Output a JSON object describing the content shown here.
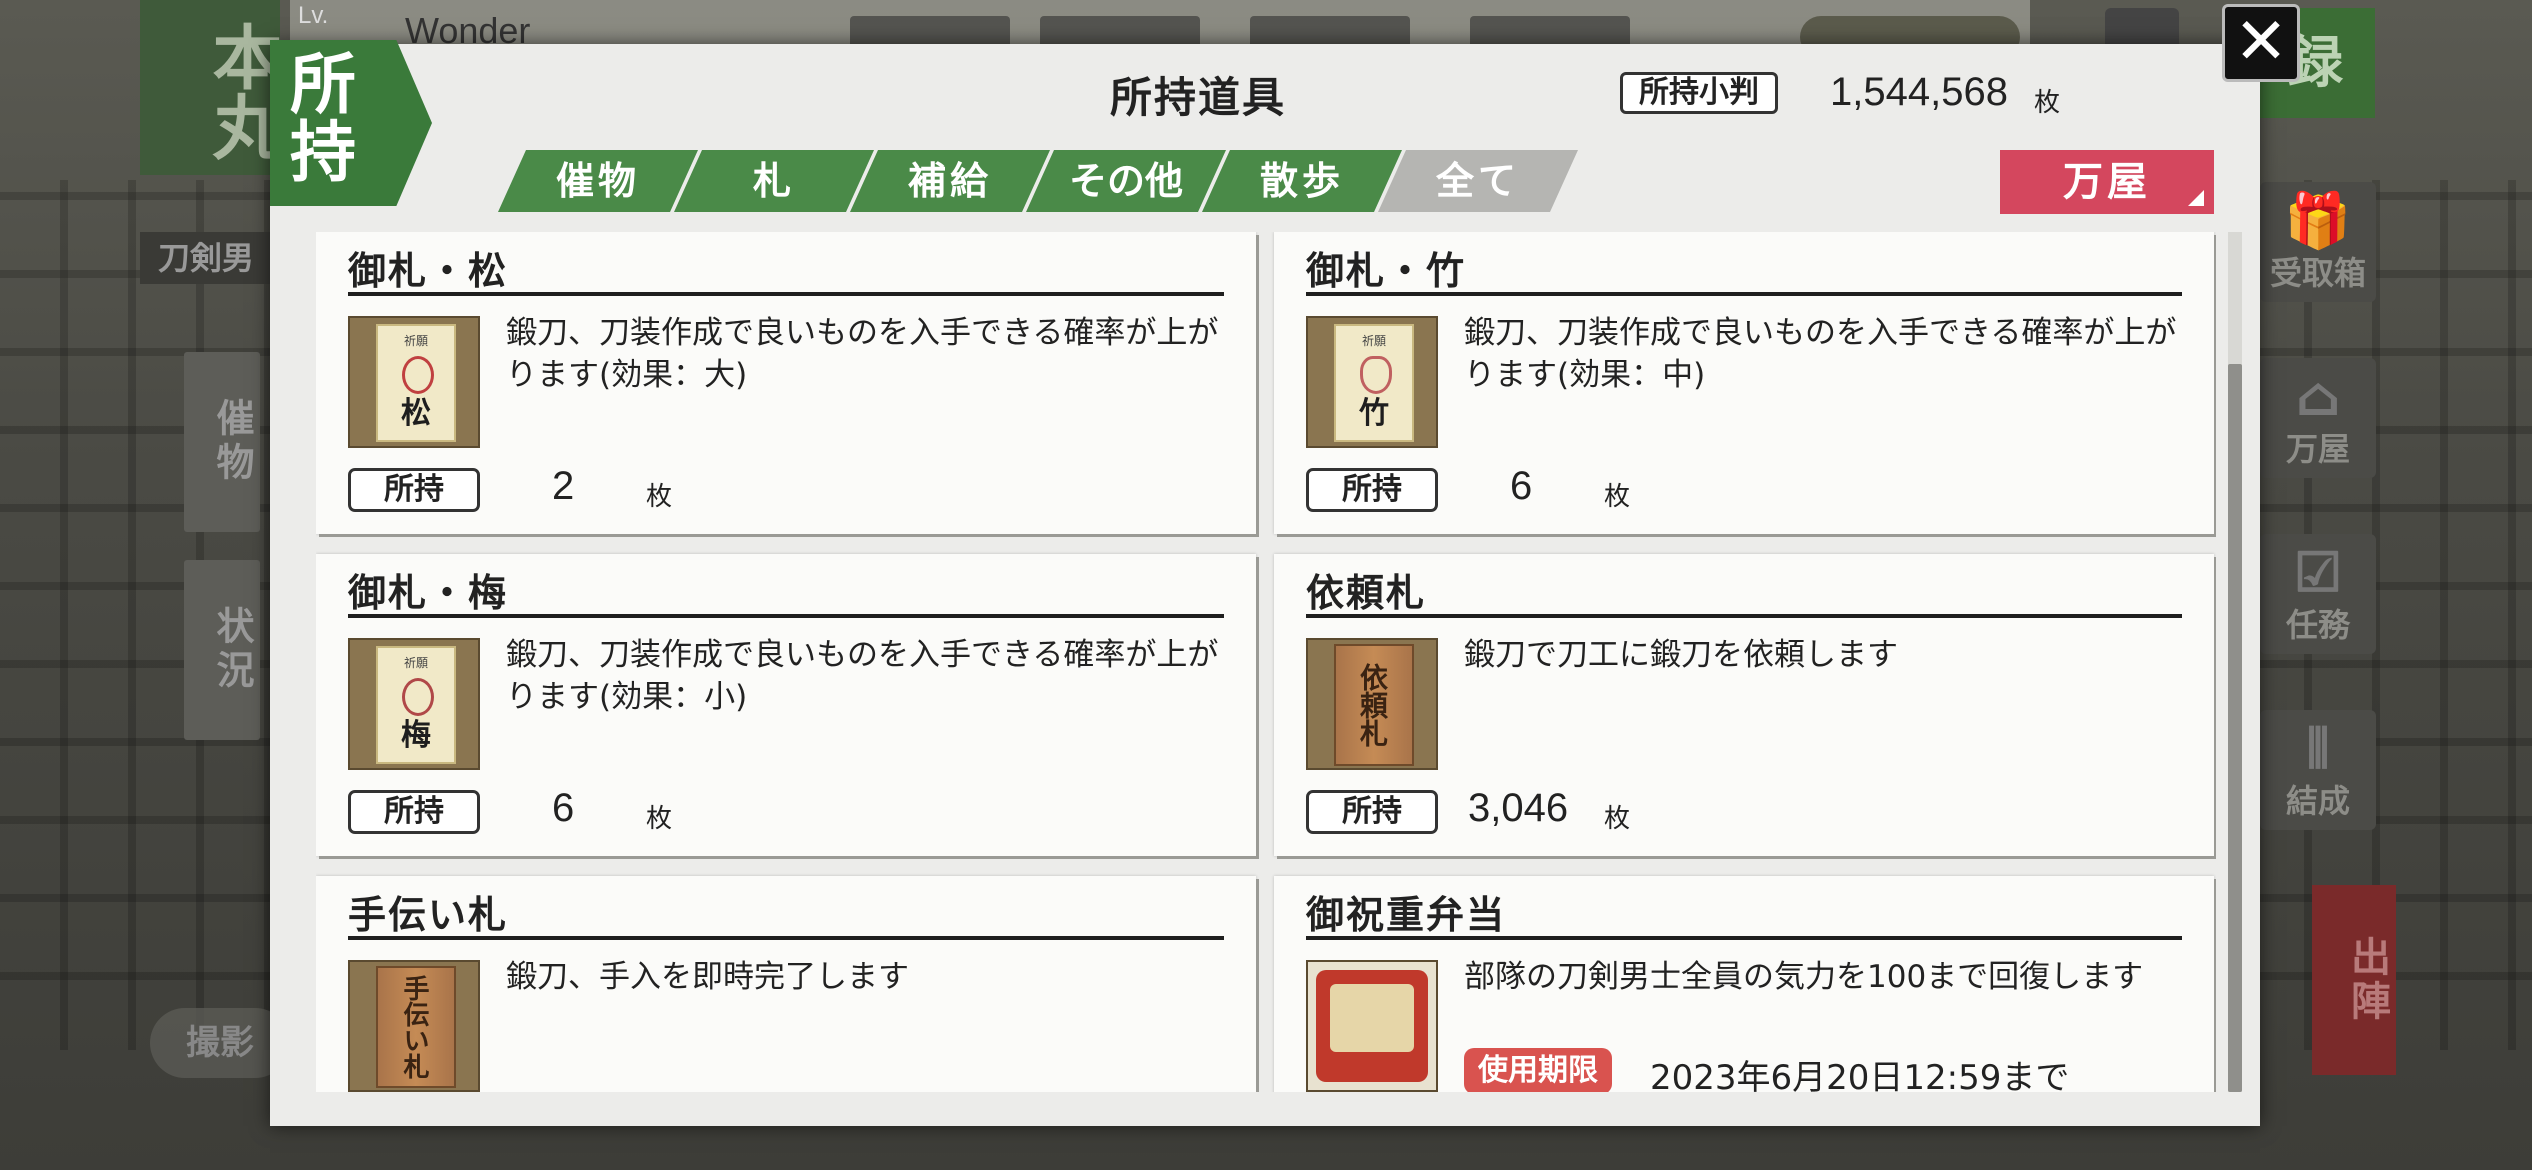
{
  "background": {
    "honmaru": "本丸",
    "level_label": "Lv.",
    "player_name": "Wonder",
    "record_button": "録",
    "left_tab": "刀剣男",
    "side_left": [
      "催物",
      "状況"
    ],
    "side_right": [
      {
        "icon": "gift-icon",
        "label": "受取箱"
      },
      {
        "icon": "shop-icon",
        "label": "万屋"
      },
      {
        "icon": "checklist-icon",
        "label": "任務"
      },
      {
        "icon": "formation-icon",
        "label": "結成"
      }
    ],
    "shutsujin": "出陣",
    "satsuei": "撮影"
  },
  "modal": {
    "badge": "所持",
    "title": "所持道具",
    "koban_label": "所持小判",
    "koban_value": "1,544,568",
    "koban_unit": "枚",
    "close_icon": "close-icon",
    "tabs": [
      {
        "label": "催物",
        "active": false
      },
      {
        "label": "札",
        "active": false
      },
      {
        "label": "補給",
        "active": false
      },
      {
        "label": "その他",
        "active": false
      },
      {
        "label": "散歩",
        "active": false
      },
      {
        "label": "全て",
        "active": true
      }
    ],
    "shop_button": "万屋",
    "own_label": "所持",
    "unit": "枚",
    "items": [
      {
        "name": "御札・松",
        "desc": "鍛刀、刀装作成で良いものを入手できる確率が上がります(効果：大)",
        "count": "2",
        "thumb": "ofuda",
        "thumb_char": "松",
        "thumb_top": "祈願"
      },
      {
        "name": "御札・竹",
        "desc": "鍛刀、刀装作成で良いものを入手できる確率が上がります(効果：中)",
        "count": "6",
        "thumb": "ofuda",
        "thumb_char": "竹",
        "thumb_top": "祈願"
      },
      {
        "name": "御札・梅",
        "desc": "鍛刀、刀装作成で良いものを入手できる確率が上がります(効果：小)",
        "count": "6",
        "thumb": "ofuda",
        "thumb_char": "梅",
        "thumb_top": "祈願"
      },
      {
        "name": "依頼札",
        "desc": "鍛刀で刀工に鍛刀を依頼します",
        "count": "3,046",
        "thumb": "plaque",
        "thumb_char": "依頼札"
      },
      {
        "name": "手伝い札",
        "desc": "鍛刀、手入を即時完了します",
        "count": "",
        "thumb": "plaque",
        "thumb_char": "手伝い札"
      },
      {
        "name": "御祝重弁当",
        "desc": "部隊の刀剣男士全員の気力を100まで回復します",
        "count": "",
        "thumb": "bento",
        "expiry_label": "使用期限",
        "expiry_text": "2023年6月20日12:59まで"
      }
    ]
  },
  "colors": {
    "tab_green": "#4a8a48",
    "tab_active_gray": "#b5b5b2",
    "shop_pink": "#d4475e",
    "expiry_red": "#d9534f"
  }
}
